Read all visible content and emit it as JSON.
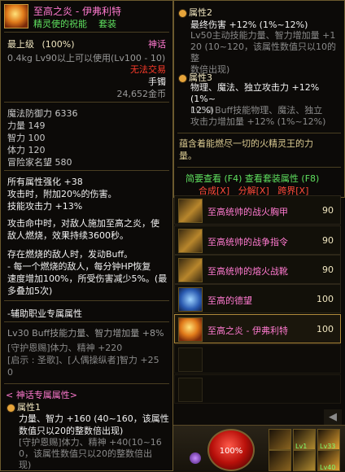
{
  "left_tooltip": {
    "item_name": "至高之炎 - 伊弗利特",
    "subtitle_a": "精灵使的祝能",
    "subtitle_b": "套装",
    "req_level": "最上级",
    "percent": "(100%)",
    "rarity": "神话",
    "weight_level": "0.4kg  Lv90以上可以使用(Lv100 - 10)",
    "untradable": "无法交易",
    "slot_type": "手镯",
    "price": "24,652金币",
    "stats": [
      {
        "label": "魔法防御力",
        "value": "6336"
      },
      {
        "label": "力量",
        "value": "149"
      },
      {
        "label": "智力",
        "value": "100"
      },
      {
        "label": "体力",
        "value": "120"
      },
      {
        "label": "冒险家名望",
        "value": "580"
      }
    ],
    "effects": [
      "所有属性强化 +38",
      "攻击时，附加20%的伤害。",
      "技能攻击力 +13%"
    ],
    "desc1": [
      "攻击命中时，对敌人施加至高之炎，使",
      "敌人燃烧，效果持续3600秒。"
    ],
    "desc2": [
      "存在燃烧的敌人时，发动Buff。",
      "- 每一个燃烧的敌人，每分钟HP恢复",
      "速度增加100%，所受伤害减少5%。(最",
      "多叠加5次)"
    ],
    "aux_title": "-辅助职业专属属性",
    "aux_line": "Lv30 Buff技能力量、智力增加量 +8%",
    "aux_gray": [
      "[守护恩赐]体力、精神 +220",
      "[启示 : 圣歌]、[人偶操纵者]智力 +25",
      "0"
    ],
    "myth_title": "< 神话专属属性>",
    "prop1_title": "属性1",
    "prop1_lines": [
      "力量、智力 +160 (40~160，该属性",
      "数值只以20的整数倍出现)"
    ],
    "prop1_gray": [
      "[守护恩赐]体力、精神 +40(10~16",
      "0，该属性数值只以20的整数倍出",
      "现)"
    ]
  },
  "right_tooltip": {
    "prop2_title": "属性2",
    "prop2_lines": [
      "最终伤害 +12% (1%~12%)"
    ],
    "prop2_gray": [
      "Lv50主动技能力量、智力增加量 +1",
      "20 (10~120，该属性数值只以10的整",
      "数倍出现)"
    ],
    "prop3_title": "属性3",
    "prop3_lines": [
      "物理、魔法、独立攻击力 +12% (1%~",
      "12%)"
    ],
    "prop3_gray": [
      "Lv30 Buff技能物理、魔法、独立",
      "攻击力增加量 +12% (1%~12%)"
    ],
    "flavor": [
      "蕴含着能燃尽一切的火精灵王的力",
      "量。"
    ],
    "simple_view": "简要查看 (F4)",
    "set_view": "查看套装属性 (F8)",
    "actions": [
      "合成[X]",
      "分解[X]",
      "跨界[X]"
    ]
  },
  "set_list": [
    {
      "name": "至高统帅的战火胸甲",
      "level": "90"
    },
    {
      "name": "至高统帅的战争指令",
      "level": "90"
    },
    {
      "name": "至高统帅的熔火战靴",
      "level": "90"
    },
    {
      "name": "至高的德望",
      "level": "100"
    },
    {
      "name": "至高之炎 - 伊弗利特",
      "level": "100"
    }
  ],
  "hud": {
    "hp_percent": "100%",
    "skill_tags": [
      "Lv1",
      "Lv33",
      "Lv40"
    ],
    "scroll_up": "▲",
    "scroll_left": "◀"
  }
}
